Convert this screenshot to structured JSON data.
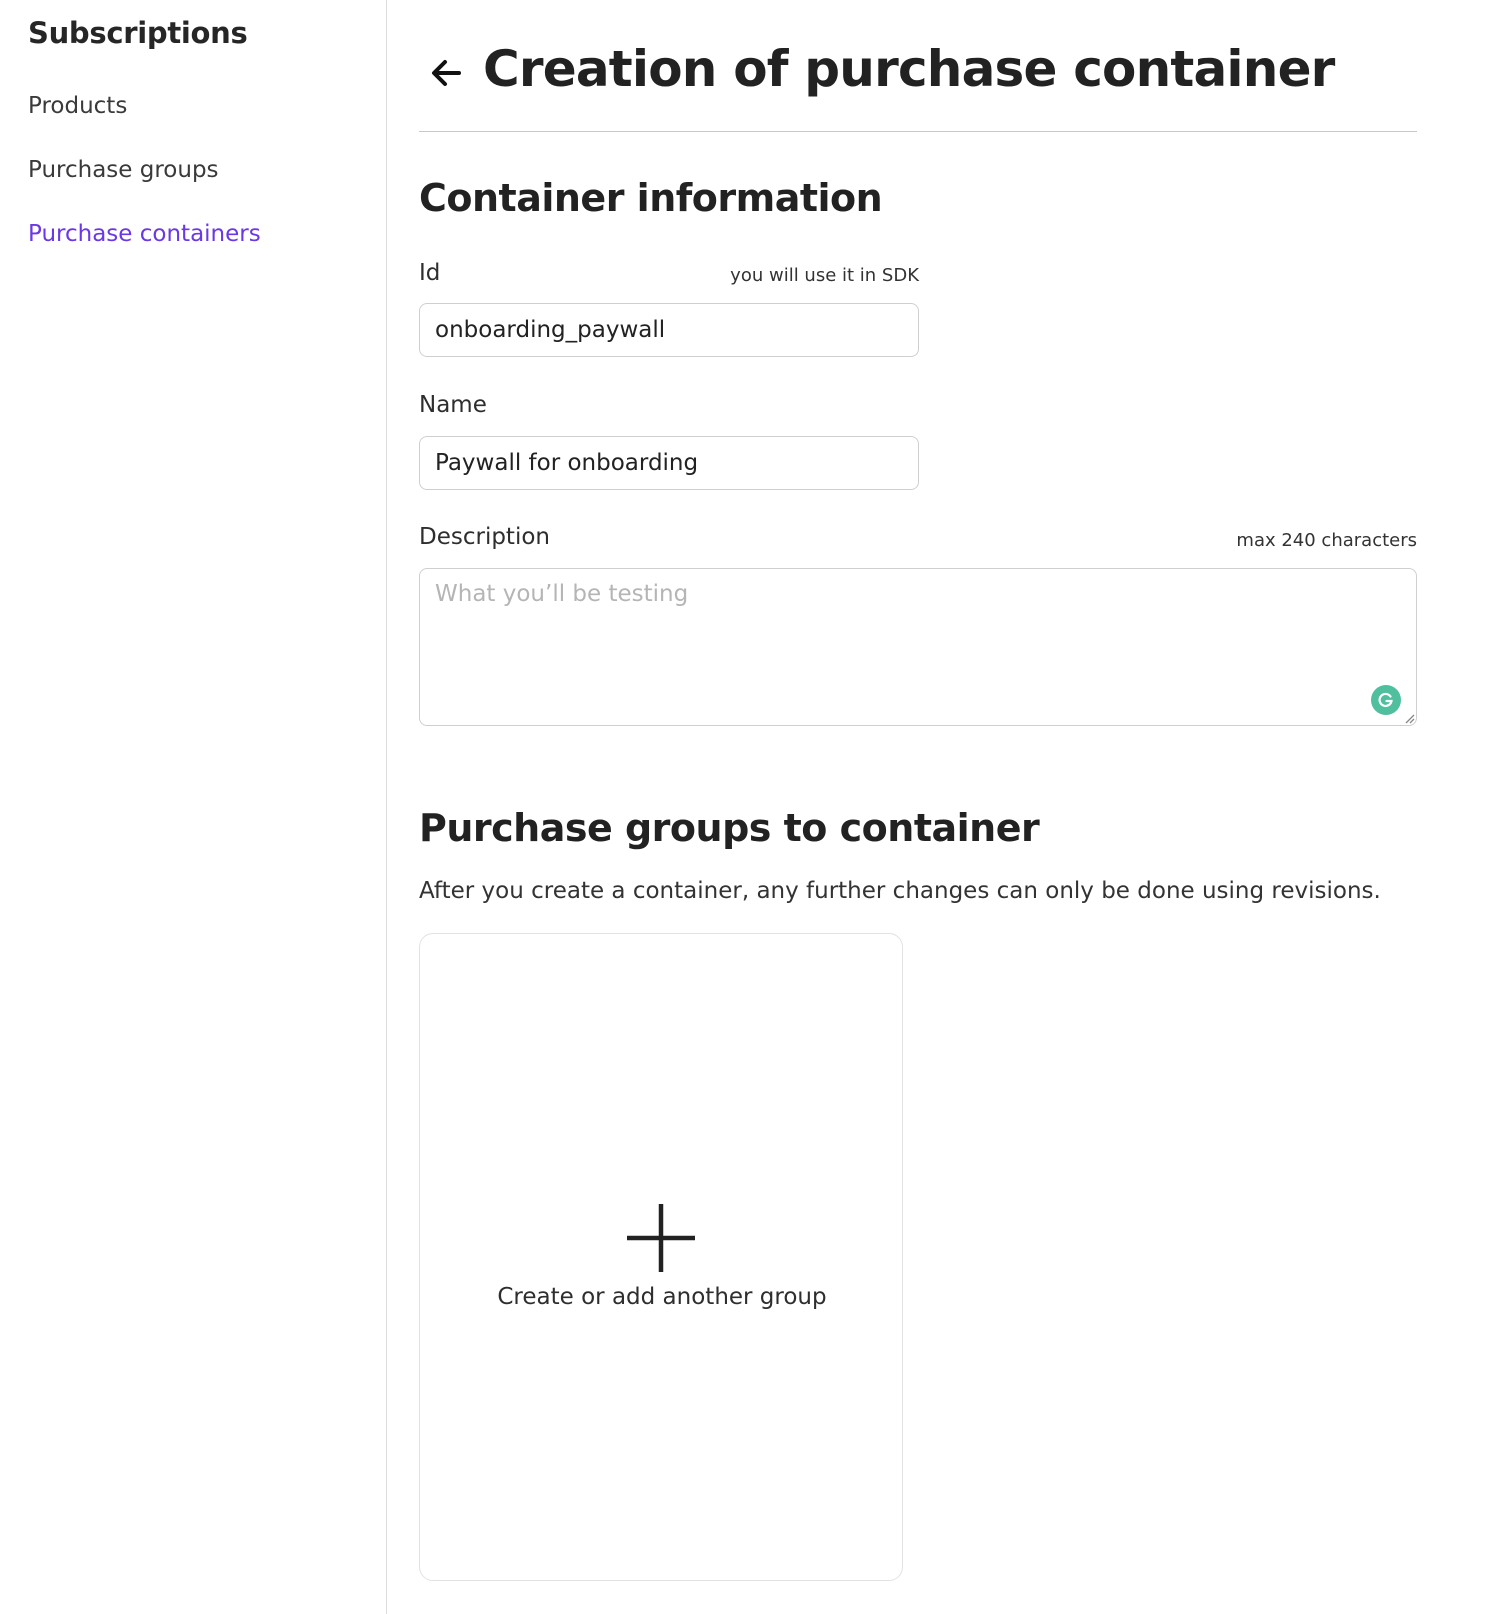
{
  "sidebar": {
    "title": "Subscriptions",
    "items": [
      {
        "label": "Products",
        "active": false
      },
      {
        "label": "Purchase groups",
        "active": false
      },
      {
        "label": "Purchase containers",
        "active": true
      }
    ],
    "active_color": "#6a38e6"
  },
  "header": {
    "back_icon": "arrow-left-icon",
    "title": "Creation of purchase container"
  },
  "container_info": {
    "title": "Container information",
    "id_field": {
      "label": "Id",
      "hint": "you will use it in SDK",
      "value": "onboarding_paywall"
    },
    "name_field": {
      "label": "Name",
      "value": "Paywall for onboarding"
    },
    "description_field": {
      "label": "Description",
      "hint": "max 240 characters",
      "value": "",
      "placeholder": "What you’ll be testing"
    },
    "grammarly_icon": "grammarly-icon"
  },
  "purchase_groups": {
    "title": "Purchase groups to container",
    "description": "After you create a container, any further changes can only be done using revisions.",
    "add_card": {
      "icon": "plus-icon",
      "label": "Create or add another group"
    }
  }
}
